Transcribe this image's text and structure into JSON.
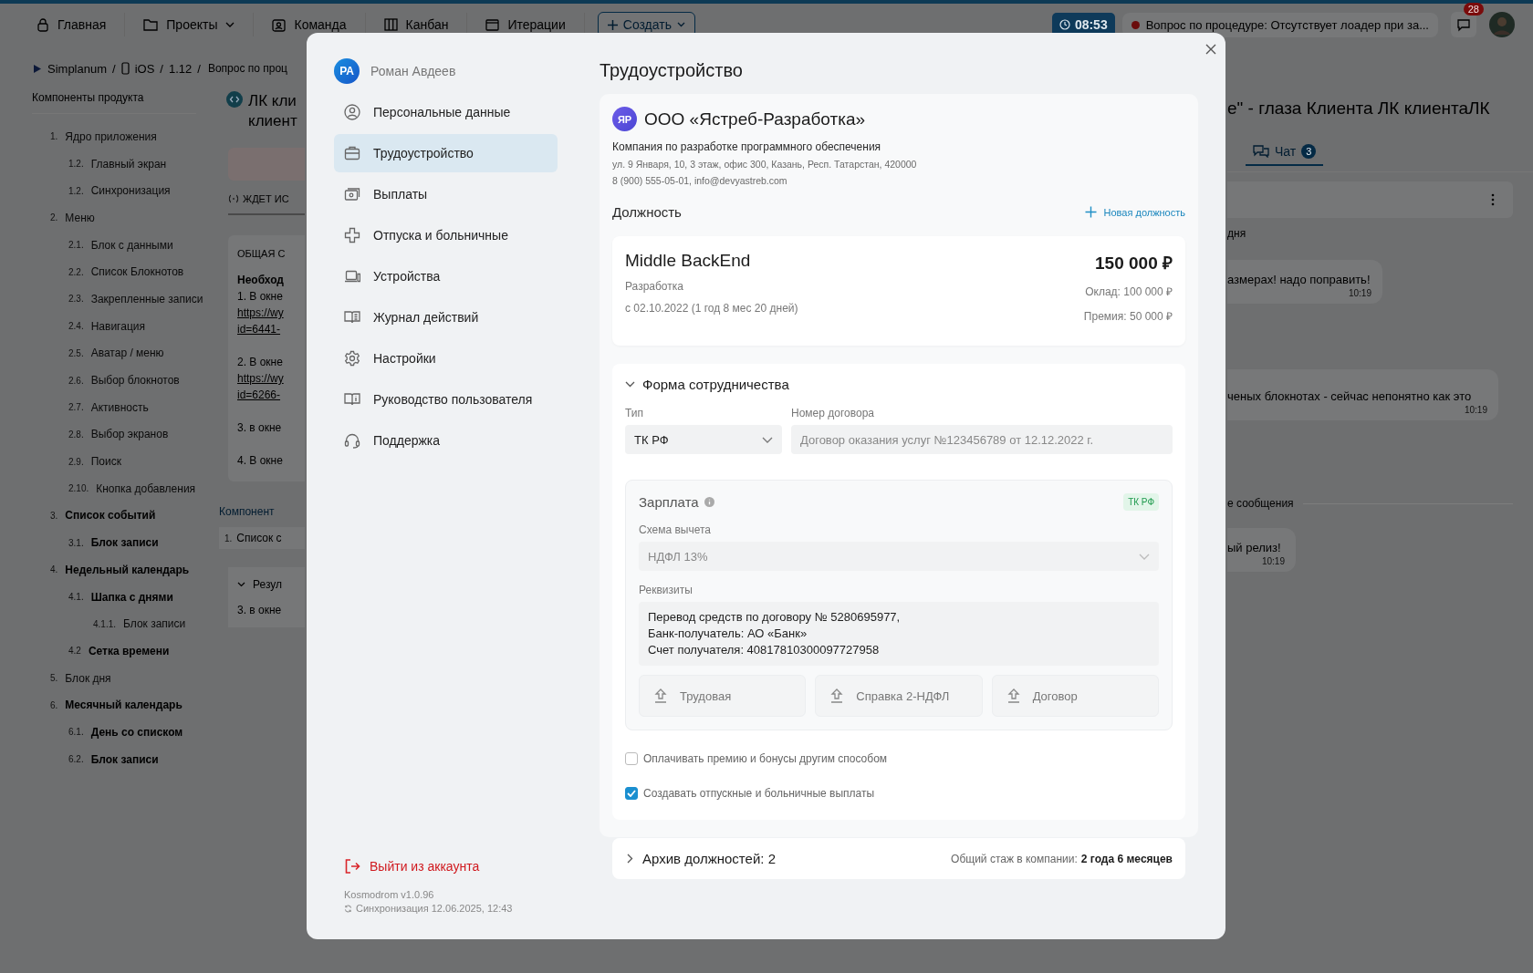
{
  "topbar": {
    "nav": [
      {
        "label": "Главная",
        "kind": "home",
        "dropdown": false
      },
      {
        "label": "Проекты",
        "kind": "folder",
        "dropdown": true
      },
      {
        "label": "Команда",
        "kind": "team",
        "dropdown": false
      },
      {
        "label": "Канбан",
        "kind": "kanban",
        "dropdown": false
      },
      {
        "label": "Итерации",
        "kind": "calendar",
        "dropdown": false
      }
    ],
    "create_button": "Создать",
    "timer": "08:53",
    "notification": "Вопрос по процедуре: Отсутствует лоадер при за...",
    "chat_badge": "28"
  },
  "breadcrumb": {
    "separator": "/",
    "items": [
      "Simplanum",
      "iOS",
      "1.12",
      "Вопрос по проц"
    ]
  },
  "tree": {
    "title": "Компоненты продукта",
    "items": [
      {
        "number": "1.",
        "label": "Ядро приложения",
        "highlighted": false,
        "children": [
          {
            "number": "1.2.",
            "label": "Главный экран",
            "highlighted": false
          },
          {
            "number": "1.2.",
            "label": "Синхронизация",
            "highlighted": false
          }
        ]
      },
      {
        "number": "2.",
        "label": "Меню",
        "highlighted": false,
        "children": [
          {
            "number": "2.1.",
            "label": "Блок с данными",
            "highlighted": false
          },
          {
            "number": "2.2.",
            "label": "Список Блокнотов",
            "highlighted": false
          },
          {
            "number": "2.3.",
            "label": "Закрепленные записи",
            "highlighted": false
          },
          {
            "number": "2.4.",
            "label": "Навигация",
            "highlighted": false
          },
          {
            "number": "2.5.",
            "label": "Аватар / меню",
            "highlighted": false
          },
          {
            "number": "2.6.",
            "label": "Выбор блокнотов",
            "highlighted": false
          },
          {
            "number": "2.7.",
            "label": "Активность",
            "highlighted": false
          },
          {
            "number": "2.8.",
            "label": "Выбор экранов",
            "highlighted": false
          },
          {
            "number": "2.9.",
            "label": "Поиск",
            "highlighted": false
          },
          {
            "number": "2.10.",
            "label": "Кнопка добавления",
            "highlighted": false
          }
        ]
      },
      {
        "number": "3.",
        "label": "Список событий",
        "highlighted": true,
        "children": [
          {
            "number": "3.1.",
            "label": "Блок записи",
            "highlighted": true
          }
        ]
      },
      {
        "number": "4.",
        "label": "Недельный календарь",
        "highlighted": true,
        "children": [
          {
            "number": "4.1.",
            "label": "Шапка с днями",
            "highlighted": true,
            "children": [
              {
                "number": "4.1.1.",
                "label": "Блок записи",
                "highlighted": false
              }
            ]
          },
          {
            "number": "4.2",
            "label": "Сетка времени",
            "highlighted": true
          }
        ]
      },
      {
        "number": "5.",
        "label": "Блок дня",
        "highlighted": false
      },
      {
        "number": "6.",
        "label": "Месячный календарь",
        "highlighted": true,
        "children": [
          {
            "number": "6.1.",
            "label": "День со списком",
            "highlighted": true
          },
          {
            "number": "6.2.",
            "label": "Блок записи",
            "highlighted": true
          }
        ]
      }
    ]
  },
  "issue_fragment": {
    "title_lines": [
      "ЛК кли",
      "клиент"
    ],
    "status": "ЖДЕТ ИС",
    "heading": "ОБЩАЯ С",
    "paragraphs": [
      [
        {
          "kind": "bold",
          "text": "Необход"
        },
        {
          "kind": "text",
          "text": "1. В окне"
        },
        {
          "kind": "link",
          "text": "https://wy"
        },
        {
          "kind": "link",
          "text": "id=6441-"
        }
      ],
      [
        {
          "kind": "text",
          "text": "2. В окне"
        },
        {
          "kind": "link",
          "text": "https://wy"
        },
        {
          "kind": "link",
          "text": "id=6266-"
        }
      ],
      [
        {
          "kind": "text",
          "text": "3. в окне"
        }
      ],
      [
        {
          "kind": "text",
          "text": "4. В окне"
        }
      ]
    ],
    "components_link": "Компонент",
    "component_chip": {
      "number": "1.",
      "label": "Список с"
    },
    "result": {
      "title": "Резул",
      "text": "3. в окне"
    }
  },
  "chat_fragment": {
    "title": "е\" - глаза Клиента ЛК клиентаЛК",
    "tab": {
      "label": "Чат",
      "badge": "3"
    },
    "day_label": "дня",
    "messages": [
      {
        "text": "азмерах! надо поправить!",
        "time": "10:19"
      },
      {
        "text": "ченых блокнотах - сейчас непонятно как это",
        "time": "10:19"
      }
    ],
    "divider": "е сообщения",
    "last_message": {
      "text": "ый релиз!",
      "time": "10:19"
    }
  },
  "modal": {
    "user": {
      "initials": "РА",
      "name": "Роман Авдеев"
    },
    "nav": [
      {
        "label": "Персональные данные",
        "kind": "person",
        "selected": false
      },
      {
        "label": "Трудоустройство",
        "kind": "briefcase",
        "selected": true
      },
      {
        "label": "Выплаты",
        "kind": "cash",
        "selected": false
      },
      {
        "label": "Отпуска и больничные",
        "kind": "cross",
        "selected": false
      },
      {
        "label": "Устройства",
        "kind": "laptop",
        "selected": false
      },
      {
        "label": "Журнал действий",
        "kind": "journal",
        "selected": false
      },
      {
        "label": "Настройки",
        "kind": "gear",
        "selected": false
      },
      {
        "label": "Руководство пользователя",
        "kind": "book",
        "selected": false
      },
      {
        "label": "Поддержка",
        "kind": "headset",
        "selected": false
      }
    ],
    "logout": "Выйти из аккаунта",
    "version": "Kosmodrom v1.0.96",
    "sync": "Синхронизация 12.06.2025, 12:43",
    "title": "Трудоустройство",
    "company": {
      "initials": "ЯР",
      "name": "ООО «Ястреб-Разработка»",
      "description": "Компания по разработке программного обеспечения",
      "address": "ул. 9 Января, 10, 3 этаж, офис 300, Казань, Респ. Татарстан, 420000",
      "contacts": "8 (900) 555-05-01, info@devyastreb.com"
    },
    "position_heading": "Должность",
    "new_position": "Новая должность",
    "position": {
      "title": "Middle BackEnd",
      "department": "Разработка",
      "since": "с 02.10.2022 (1 год 8 мес 20 дней)",
      "total": "150 000 ₽",
      "salary": "Оклад: 100 000 ₽",
      "bonus": "Премия: 50 000 ₽"
    },
    "cooperation": {
      "title": "Форма сотрудничества",
      "expanded": true,
      "type_label": "Тип",
      "type_value": "ТК РФ",
      "contract_label": "Номер договора",
      "contract_placeholder": "Договор оказания услуг №123456789 от 12.12.2022 г.",
      "salary": {
        "title": "Зарплата",
        "tag": "ТК РФ",
        "scheme_label": "Схема вычета",
        "scheme_value": "НДФЛ 13%",
        "details_label": "Реквизиты",
        "details_lines": [
          "Перевод средств по договору № 5280695977,",
          "Банк-получатель: АО «Банк»",
          "Счет получателя: 40817810300097727958"
        ],
        "uploads": [
          "Трудовая",
          "Справка 2-НДФЛ",
          "Договор"
        ]
      },
      "options": [
        {
          "label": "Оплачивать премию и бонусы другим способом",
          "checked": false
        },
        {
          "label": "Создавать отпускные и больничные выплаты",
          "checked": true
        }
      ]
    },
    "archive": {
      "title": "Архив должностей: 2",
      "expanded": false,
      "tenure_label": "Общий стаж в компании:",
      "tenure_value": "2 года 6 месяцев"
    }
  }
}
